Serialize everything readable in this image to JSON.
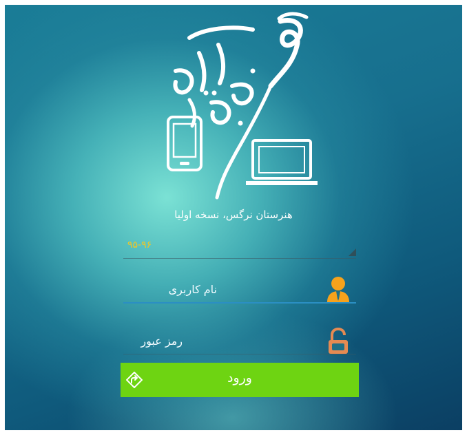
{
  "app": {
    "logo_text": "نظم آینده",
    "subtitle": "هنرستان نرگس، نسخه اولیا"
  },
  "year_select": {
    "value": "۹۵-۹۶"
  },
  "username": {
    "placeholder": "نام کاربری",
    "value": ""
  },
  "password": {
    "placeholder": "رمز عبور",
    "value": ""
  },
  "login_button": {
    "label": "ورود"
  },
  "colors": {
    "accent_green": "#6ed412",
    "year_yellow": "#f2c623",
    "user_icon_orange": "#f6a21c",
    "lock_icon_orange": "#e58a52",
    "focus_blue": "#2b8fc3"
  },
  "icons": {
    "user": "user-icon",
    "lock": "lock-icon",
    "login": "login-arrow-icon"
  }
}
